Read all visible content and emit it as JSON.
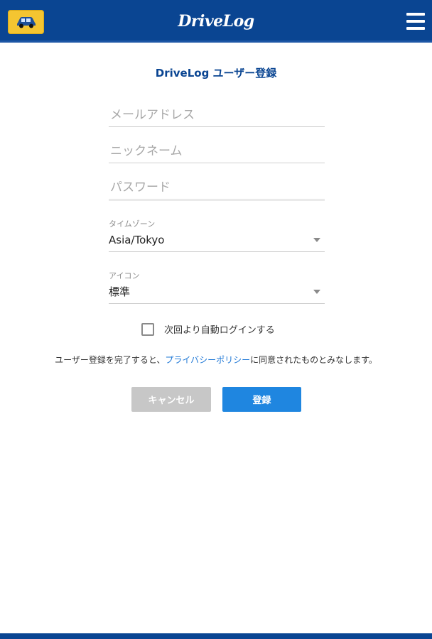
{
  "header": {
    "brand": "DriveLog",
    "car_icon": "car-icon",
    "menu_icon": "hamburger-menu-icon",
    "background_color": "#0a4592",
    "car_button_color": "#f4c531"
  },
  "form": {
    "title": "DriveLog ユーザー登録",
    "email": {
      "placeholder": "メールアドレス",
      "value": ""
    },
    "nickname": {
      "placeholder": "ニックネーム",
      "value": ""
    },
    "password": {
      "placeholder": "パスワード",
      "value": ""
    },
    "timezone": {
      "label": "タイムゾーン",
      "value": "Asia/Tokyo"
    },
    "icon": {
      "label": "アイコン",
      "value": "標準"
    },
    "auto_login": {
      "label": "次回より自動ログインする",
      "checked": false
    },
    "privacy": {
      "before": "ユーザー登録を完了すると、",
      "link": "プライバシーポリシー",
      "after": "に同意されたものとみなします。"
    },
    "cancel_label": "キャンセル",
    "register_label": "登録"
  },
  "colors": {
    "accent": "#1f86e0",
    "link": "#1f78d6",
    "disabled": "#c7c7c7"
  }
}
